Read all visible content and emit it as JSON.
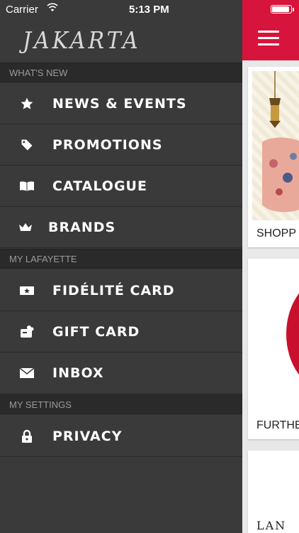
{
  "status_bar": {
    "carrier": "Carrier",
    "time": "5:13 PM"
  },
  "drawer": {
    "logo": "JAKARTA",
    "sections": [
      {
        "header": "WHAT'S NEW"
      },
      {
        "header": "MY LAFAYETTE"
      },
      {
        "header": "MY SETTINGS"
      }
    ],
    "items": [
      {
        "label": "NEWS & EVENTS",
        "icon": "star-icon"
      },
      {
        "label": "PROMOTIONS",
        "icon": "tag-icon"
      },
      {
        "label": "CATALOGUE",
        "icon": "book-icon"
      },
      {
        "label": "BRANDS",
        "icon": "crown-icon"
      },
      {
        "label": "FIDÉLITÉ CARD",
        "icon": "card-star-icon"
      },
      {
        "label": "GIFT CARD",
        "icon": "gift-card-icon"
      },
      {
        "label": "INBOX",
        "icon": "envelope-icon"
      },
      {
        "label": "PRIVACY",
        "icon": "lock-icon"
      }
    ]
  },
  "main": {
    "accent_color": "#d7143c",
    "cards": [
      {
        "caption": "SHOPP"
      },
      {
        "caption": "FURTHE"
      },
      {
        "caption": "LAN"
      }
    ]
  }
}
